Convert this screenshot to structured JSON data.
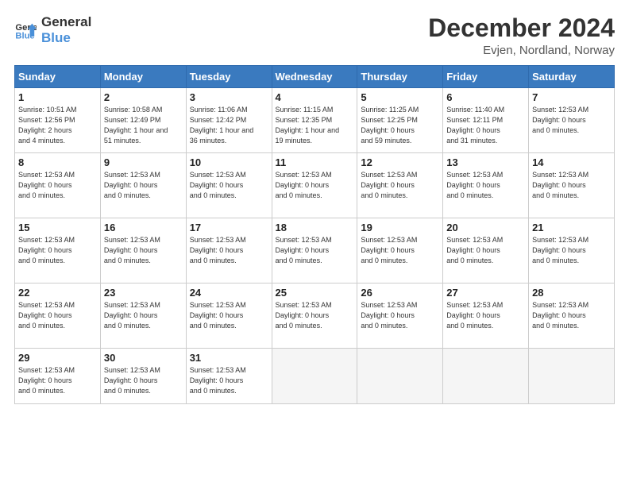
{
  "logo": {
    "line1": "General",
    "line2": "Blue",
    "icon_color": "#4a90d9"
  },
  "header": {
    "month": "December 2024",
    "location": "Evjen, Nordland, Norway"
  },
  "weekdays": [
    "Sunday",
    "Monday",
    "Tuesday",
    "Wednesday",
    "Thursday",
    "Friday",
    "Saturday"
  ],
  "weeks": [
    [
      {
        "num": "1",
        "info": "Sunrise: 10:51 AM\nSunset: 12:56 PM\nDaylight: 2 hours\nand 4 minutes."
      },
      {
        "num": "2",
        "info": "Sunrise: 10:58 AM\nSunset: 12:49 PM\nDaylight: 1 hour and\n51 minutes."
      },
      {
        "num": "3",
        "info": "Sunrise: 11:06 AM\nSunset: 12:42 PM\nDaylight: 1 hour and\n36 minutes."
      },
      {
        "num": "4",
        "info": "Sunrise: 11:15 AM\nSunset: 12:35 PM\nDaylight: 1 hour and\n19 minutes."
      },
      {
        "num": "5",
        "info": "Sunrise: 11:25 AM\nSunset: 12:25 PM\nDaylight: 0 hours\nand 59 minutes."
      },
      {
        "num": "6",
        "info": "Sunrise: 11:40 AM\nSunset: 12:11 PM\nDaylight: 0 hours\nand 31 minutes."
      },
      {
        "num": "7",
        "info": "Sunset: 12:53 AM\nDaylight: 0 hours\nand 0 minutes."
      }
    ],
    [
      {
        "num": "8",
        "info": "Sunset: 12:53 AM\nDaylight: 0 hours\nand 0 minutes."
      },
      {
        "num": "9",
        "info": "Sunset: 12:53 AM\nDaylight: 0 hours\nand 0 minutes."
      },
      {
        "num": "10",
        "info": "Sunset: 12:53 AM\nDaylight: 0 hours\nand 0 minutes."
      },
      {
        "num": "11",
        "info": "Sunset: 12:53 AM\nDaylight: 0 hours\nand 0 minutes."
      },
      {
        "num": "12",
        "info": "Sunset: 12:53 AM\nDaylight: 0 hours\nand 0 minutes."
      },
      {
        "num": "13",
        "info": "Sunset: 12:53 AM\nDaylight: 0 hours\nand 0 minutes."
      },
      {
        "num": "14",
        "info": "Sunset: 12:53 AM\nDaylight: 0 hours\nand 0 minutes."
      }
    ],
    [
      {
        "num": "15",
        "info": "Sunset: 12:53 AM\nDaylight: 0 hours\nand 0 minutes."
      },
      {
        "num": "16",
        "info": "Sunset: 12:53 AM\nDaylight: 0 hours\nand 0 minutes."
      },
      {
        "num": "17",
        "info": "Sunset: 12:53 AM\nDaylight: 0 hours\nand 0 minutes."
      },
      {
        "num": "18",
        "info": "Sunset: 12:53 AM\nDaylight: 0 hours\nand 0 minutes."
      },
      {
        "num": "19",
        "info": "Sunset: 12:53 AM\nDaylight: 0 hours\nand 0 minutes."
      },
      {
        "num": "20",
        "info": "Sunset: 12:53 AM\nDaylight: 0 hours\nand 0 minutes."
      },
      {
        "num": "21",
        "info": "Sunset: 12:53 AM\nDaylight: 0 hours\nand 0 minutes."
      }
    ],
    [
      {
        "num": "22",
        "info": "Sunset: 12:53 AM\nDaylight: 0 hours\nand 0 minutes."
      },
      {
        "num": "23",
        "info": "Sunset: 12:53 AM\nDaylight: 0 hours\nand 0 minutes."
      },
      {
        "num": "24",
        "info": "Sunset: 12:53 AM\nDaylight: 0 hours\nand 0 minutes."
      },
      {
        "num": "25",
        "info": "Sunset: 12:53 AM\nDaylight: 0 hours\nand 0 minutes."
      },
      {
        "num": "26",
        "info": "Sunset: 12:53 AM\nDaylight: 0 hours\nand 0 minutes."
      },
      {
        "num": "27",
        "info": "Sunset: 12:53 AM\nDaylight: 0 hours\nand 0 minutes."
      },
      {
        "num": "28",
        "info": "Sunset: 12:53 AM\nDaylight: 0 hours\nand 0 minutes."
      }
    ],
    [
      {
        "num": "29",
        "info": "Sunset: 12:53 AM\nDaylight: 0 hours\nand 0 minutes."
      },
      {
        "num": "30",
        "info": "Sunset: 12:53 AM\nDaylight: 0 hours\nand 0 minutes."
      },
      {
        "num": "31",
        "info": "Sunset: 12:53 AM\nDaylight: 0 hours\nand 0 minutes."
      },
      {
        "num": "",
        "info": ""
      },
      {
        "num": "",
        "info": ""
      },
      {
        "num": "",
        "info": ""
      },
      {
        "num": "",
        "info": ""
      }
    ]
  ]
}
